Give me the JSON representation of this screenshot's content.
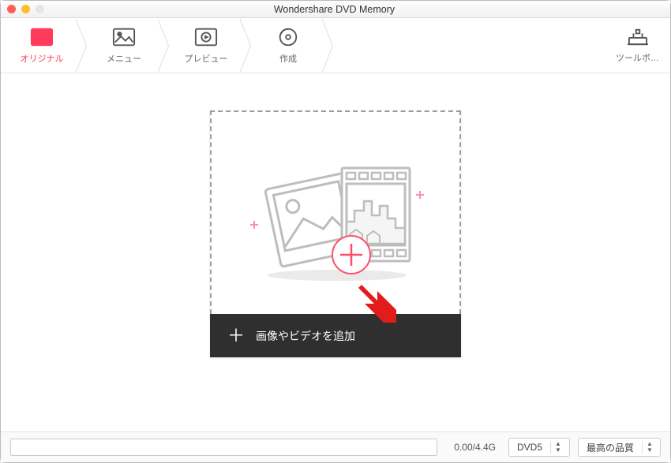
{
  "window": {
    "title": "Wondershare DVD Memory"
  },
  "steps": {
    "original": "オリジナル",
    "menu": "メニュー",
    "preview": "プレビュー",
    "create": "作成"
  },
  "toolbox": {
    "label": "ツールボ…"
  },
  "dropzone": {
    "add_label": "画像やビデオを追加"
  },
  "footer": {
    "size_text": "0.00/4.4G",
    "disc_type": "DVD5",
    "quality": "最高の品質"
  }
}
